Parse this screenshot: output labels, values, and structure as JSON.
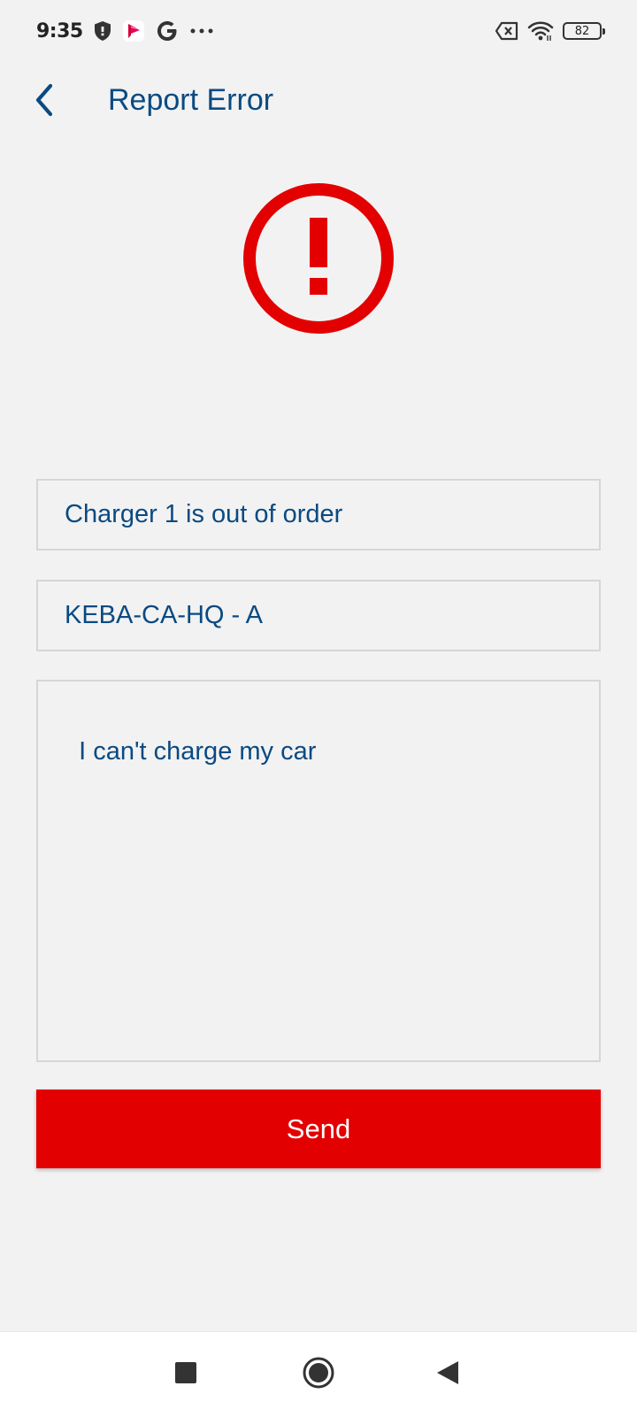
{
  "status_bar": {
    "time": "9:35",
    "battery_level": "82",
    "icons_left": [
      "shield-icon",
      "app-notification-icon",
      "google-icon",
      "more-dots-icon"
    ],
    "icons_right": [
      "no-sim-icon",
      "wifi-icon",
      "battery-icon"
    ]
  },
  "header": {
    "title": "Report Error",
    "back_icon": "chevron-left-icon"
  },
  "error_icon": {
    "name": "alert-circle-icon",
    "color": "#e30000"
  },
  "form": {
    "subject_value": "Charger 1 is out of order",
    "charger_value": "KEBA-CA-HQ - A",
    "description_value": "I can't charge my car"
  },
  "send_button": {
    "label": "Send",
    "color": "#e30000"
  },
  "nav_bar": {
    "items": [
      "recents-square-icon",
      "home-circle-icon",
      "back-triangle-icon"
    ]
  },
  "colors": {
    "primary_text": "#0a4a82",
    "background": "#f2f2f2",
    "accent": "#e30000"
  }
}
